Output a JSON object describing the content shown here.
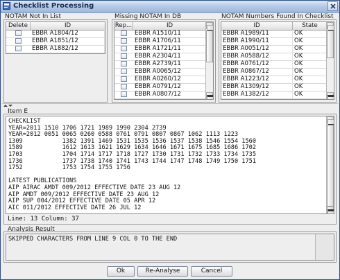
{
  "window": {
    "title": "Checklist Processing"
  },
  "notam_not_in_list": {
    "label": "NOTAM Not In List",
    "headers": [
      "Delete",
      "ID"
    ],
    "rows": [
      "EBBR A1804/12",
      "EBBR A1851/12",
      "EBBR A1882/12"
    ]
  },
  "missing_notam": {
    "label": "Missing NOTAM In DB",
    "headers": [
      "Rep...",
      "ID"
    ],
    "rows": [
      "EBBR A1510/11",
      "EBBR A1706/11",
      "EBBR A1721/11",
      "EBBR A2304/11",
      "EBBR A2739/11",
      "EBBR A0065/12",
      "EBBR A0260/12",
      "EBBR A0791/12",
      "EBBR A0807/12"
    ]
  },
  "numbers_found": {
    "label": "NOTAM Numbers Found In Checklist",
    "headers": [
      "ID",
      "State"
    ],
    "rows": [
      {
        "id": "EBBR A1989/11",
        "state": "OK"
      },
      {
        "id": "EBBR A1990/11",
        "state": "OK"
      },
      {
        "id": "EBBR A0051/12",
        "state": "OK"
      },
      {
        "id": "EBBR A0588/12",
        "state": "OK"
      },
      {
        "id": "EBBR A0761/12",
        "state": "OK"
      },
      {
        "id": "EBBR A0867/12",
        "state": "OK"
      },
      {
        "id": "EBBR A1223/12",
        "state": "OK"
      },
      {
        "id": "EBBR A1309/12",
        "state": "OK"
      },
      {
        "id": "EBBR A1382/12",
        "state": "OK"
      }
    ]
  },
  "item_e": {
    "label": "Item E",
    "lines": [
      "CHECKLIST",
      "YEAR=2011 1510 1706 1721 1989 1990 2304 2739",
      "YEAR=2012 0051 0065 0260 0588 0761 0791 0807 0867 1062 1113 1223",
      "1309           1382 1391 1469 1531 1535 1536 1537 1538 1546 1554 1560",
      "1589           1612 1613 1621 1629 1634 1646 1671 1675 1685 1686 1702",
      "1703           1704 1714 1717 1718 1727 1730 1731 1732 1733 1734 1735",
      "1736           1737 1738 1740 1741 1743 1744 1747 1748 1749 1750 1751",
      "1752           1753 1754 1755 1756",
      "",
      "LATEST PUBLICATIONS",
      "AIP AIRAC AMDT 009/2012 EFFECTIVE DATE 23 AUG 12",
      "AIP AMDT 009/2012 EFFECTIVE DATE 23 AUG 12",
      "AIP SUP 004/2012 EFFECTIVE DATE 05 APR 12",
      "AIC 011/2012 EFFECTIVE DATE 26 JUL 12"
    ],
    "status": "Line: 13 Column: 37"
  },
  "analysis": {
    "label": "Analysis Result",
    "text": "SKIPPED CHARACTERS FROM LINE 9 COL 0 TO THE END"
  },
  "buttons": {
    "ok": "Ok",
    "reanalyse": "Re-Analyse",
    "cancel": "Cancel"
  }
}
